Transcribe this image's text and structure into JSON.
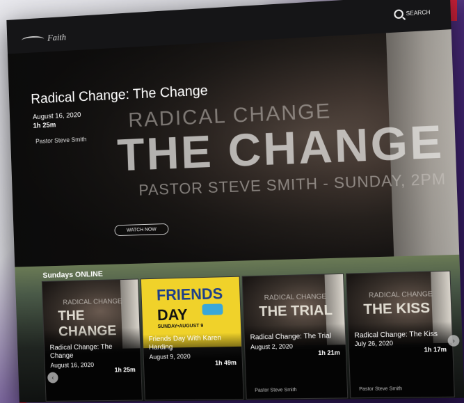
{
  "header": {
    "logo_text": "Faith",
    "search_label": "SEARCH"
  },
  "hero": {
    "title": "Radical Change: The Change",
    "date": "August 16, 2020",
    "duration": "1h 25m",
    "pastor": "Pastor Steve Smith",
    "art_line1": "RADICAL CHANGE",
    "art_line2": "THE CHANGE",
    "art_line3": "PASTOR STEVE SMITH - SUNDAY, 2PM",
    "watch_label": "WATCH NOW"
  },
  "section": {
    "title": "Sundays ONLINE"
  },
  "cards": [
    {
      "title": "Radical Change: The Change",
      "date": "August 16, 2020",
      "duration": "1h 25m",
      "pastor": "",
      "thumb_small": "RADICAL CHANGE",
      "thumb_big": "THE CHANGE"
    },
    {
      "title": "Friends Day With Karen Harding",
      "date": "August 9, 2020",
      "duration": "1h 49m",
      "pastor": "",
      "fd_title": "FRIENDS",
      "fd_day": "DAY",
      "fd_sub": "SUNDAY•AUGUST 9"
    },
    {
      "title": "Radical Change: The Trial",
      "date": "August 2, 2020",
      "duration": "1h 21m",
      "pastor": "Pastor Steve Smith",
      "thumb_small": "RADICAL CHANGE",
      "thumb_big": "THE TRIAL"
    },
    {
      "title": "Radical Change: The Kiss",
      "date": "July 26, 2020",
      "duration": "1h 17m",
      "pastor": "Pastor Steve Smith",
      "thumb_small": "RADICAL CHANGE",
      "thumb_big": "THE KISS"
    }
  ],
  "nav": {
    "prev_glyph": "‹",
    "next_glyph": "›"
  }
}
